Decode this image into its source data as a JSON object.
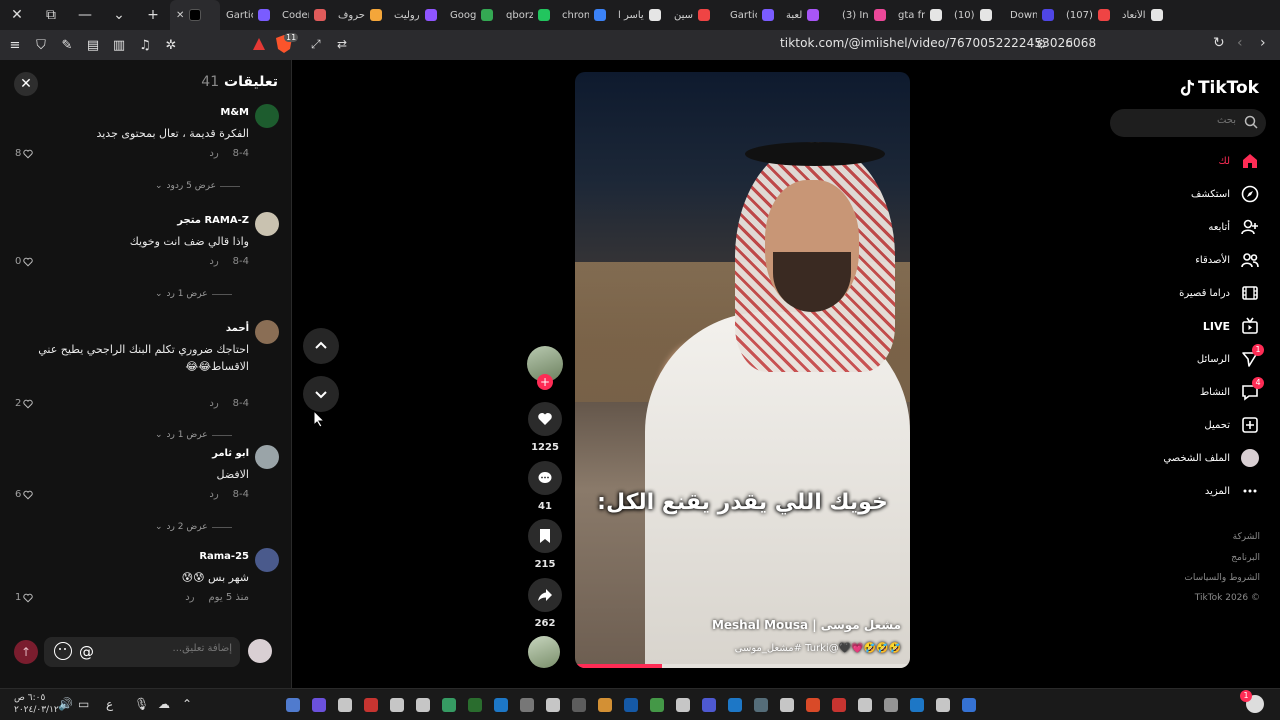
{
  "browser": {
    "tabs": [
      {
        "label": "Gartic",
        "color": "#7a5cff"
      },
      {
        "label": "Coder",
        "color": "#e05b5b"
      },
      {
        "label": "حروف",
        "color": "#f4a63a"
      },
      {
        "label": "روليت",
        "color": "#8f55ff"
      },
      {
        "label": "Goog",
        "color": "#34a853"
      },
      {
        "label": "qborz",
        "color": "#22c55e"
      },
      {
        "label": "chron",
        "color": "#3b82f6"
      },
      {
        "label": "ياسر ا",
        "color": "#e5e5e5"
      },
      {
        "label": "سين",
        "color": "#ef4444"
      },
      {
        "label": "Gartic",
        "color": "#7a5cff"
      },
      {
        "label": "لعبة",
        "color": "#a855f7"
      },
      {
        "label": "(3) Ins",
        "color": "#ec4899"
      },
      {
        "label": "gta fr",
        "color": "#e5e5e5"
      },
      {
        "label": "(10)",
        "color": "#e5e5e5"
      },
      {
        "label": "Down",
        "color": "#4f46e5"
      },
      {
        "label": "(107)",
        "color": "#ef4444"
      },
      {
        "label": "الأنعاد",
        "color": "#e5e5e5"
      }
    ],
    "url": "tiktok.com/@imiishel/video/7670052222453026068",
    "shield_count": "11"
  },
  "comments_panel": {
    "title": "تعليقات",
    "count": "41",
    "comments": [
      {
        "user": "M&M",
        "text": "الفكرة قديمة ، تعال بمحتوى جديد",
        "date": "8-4",
        "reply": "رد",
        "likes": "8",
        "replies": "عرض 5 ردود",
        "avatar": "#1d5c2e"
      },
      {
        "user": "RAMA-Z متجر",
        "text": "واذا قالي ضف انت وخويك",
        "date": "8-4",
        "reply": "رد",
        "likes": "0",
        "replies": "عرض 1 رد",
        "avatar": "#c9c2b0"
      },
      {
        "user": "أحمد",
        "text": "احتاجك ضروري تكلم البنك الراجحي يطيح عني الاقساط😂😂",
        "date": "8-4",
        "reply": "رد",
        "likes": "2",
        "replies": "عرض 1 رد",
        "avatar": "#8a6e55"
      },
      {
        "user": "ابو ثامر",
        "text": "الافضل",
        "date": "8-4",
        "reply": "رد",
        "likes": "6",
        "replies": "عرض 2 رد",
        "avatar": "#9aa4a8"
      },
      {
        "user": "Rama-25",
        "text": "شهر بس 😰😰",
        "date": "منذ 5 يوم",
        "reply": "رد",
        "likes": "1",
        "replies": "",
        "avatar": "#4a5a8c"
      }
    ],
    "input_placeholder": "إضافة تعليق..."
  },
  "video": {
    "caption": "خويك اللي يقدر يقنع الكل:",
    "author": "مشعل موسى | Meshal Mousa",
    "description": "🤣🤣🤣💗🖤@Turki #مشعل_موسى",
    "progress": 0.26
  },
  "actions": {
    "likes": "1225",
    "comments": "41",
    "saves": "215",
    "shares": "262"
  },
  "sidebar": {
    "logo": "TikTok",
    "search_placeholder": "بحث",
    "nav": [
      {
        "label": "لك",
        "icon": "home-icon",
        "active": true
      },
      {
        "label": "استكشف",
        "icon": "compass-icon"
      },
      {
        "label": "أتابعه",
        "icon": "user-follow-icon"
      },
      {
        "label": "الأصدقاء",
        "icon": "friends-icon"
      },
      {
        "label": "دراما قصيرة",
        "icon": "film-icon"
      },
      {
        "label": "LIVE",
        "icon": "live-tv-icon"
      },
      {
        "label": "الرسائل",
        "icon": "send-icon",
        "badge": "1"
      },
      {
        "label": "النشاط",
        "icon": "activity-icon",
        "badge": "4"
      },
      {
        "label": "تحميل",
        "icon": "upload-icon"
      },
      {
        "label": "الملف الشخصي",
        "icon": "profile-icon"
      },
      {
        "label": "المزيد",
        "icon": "more-icon"
      }
    ],
    "footer": [
      "الشركة",
      "البرنامج",
      "الشروط والسياسات",
      "© TikTok 2026"
    ]
  },
  "taskbar": {
    "time": "٦:٠٥ ص",
    "date": "٢٠٢٤/٠٣/١٢",
    "lang": "ع",
    "notification_count": "1"
  }
}
